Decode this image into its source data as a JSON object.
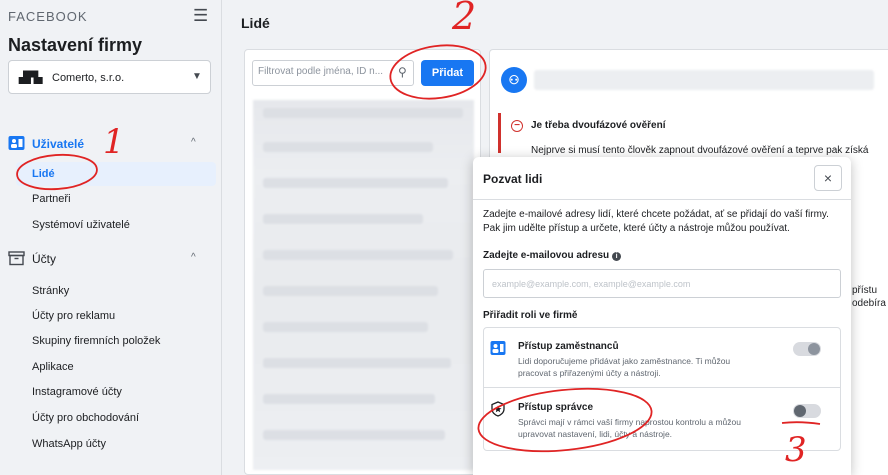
{
  "sidebar": {
    "brand": "FACEBOOK",
    "title": "Nastavení firmy",
    "company": "Comerto, s.r.o.",
    "sections": [
      {
        "label": "Uživatelé",
        "items": [
          "Lidé",
          "Partneři",
          "Systémoví uživatelé"
        ]
      },
      {
        "label": "Účty",
        "items": [
          "Stránky",
          "Účty pro reklamu",
          "Skupiny firemních položek",
          "Aplikace",
          "Instagramové účty",
          "Účty pro obchodování",
          "WhatsApp účty"
        ]
      }
    ]
  },
  "main": {
    "title": "Lidé",
    "filter_placeholder": "Filtrovat podle jména, ID n...",
    "add_button": "Přidat"
  },
  "detail": {
    "alert_title": "Je třeba dvoufázové ověření",
    "alert_text": "Nejprve si musí tento člověk zapnout dvoufázové ověření a teprve pak získá",
    "fragment1": "přístu",
    "fragment2": "odebíra"
  },
  "modal": {
    "title": "Pozvat lidi",
    "close": "×",
    "intro": "Zadejte e-mailové adresy lidí, které chcete požádat, ať se přidají do vaší firmy. Pak jim udělte přístup a určete, které účty a nástroje můžou používat.",
    "email_label": "Zadejte e-mailovou adresu",
    "email_placeholder": "example@example.com, example@example.com",
    "role_label": "Přiřadit roli ve firmě",
    "roles": [
      {
        "name": "Přístup zaměstnanců",
        "desc": "Lidi doporučujeme přidávat jako zaměstnance. Ti můžou pracovat s přiřazenými účty a nástroji.",
        "enabled": true
      },
      {
        "name": "Přístup správce",
        "desc": "Správci mají v rámci vaší firmy naprostou kontrolu a můžou upravovat nastavení, lidi, účty a nástroje.",
        "enabled": false
      }
    ]
  },
  "annotations": {
    "n1": "1",
    "n2": "2",
    "n3": "3"
  },
  "colors": {
    "accent": "#1877f2",
    "alert": "#d0312d",
    "annotation": "#e02424"
  },
  "icons": {
    "company": "company-logo-icon",
    "users": "people-badge-icon",
    "accounts": "archive-box-icon",
    "search": "search-icon",
    "info": "info-icon",
    "admin": "star-shield-icon"
  }
}
